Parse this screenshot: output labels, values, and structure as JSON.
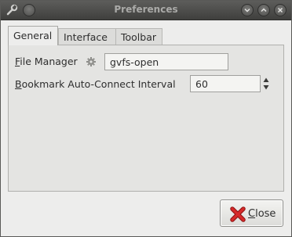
{
  "window": {
    "title": "Preferences",
    "tabs": [
      {
        "label": "General",
        "active": true
      },
      {
        "label": "Interface",
        "active": false
      },
      {
        "label": "Toolbar",
        "active": false
      }
    ]
  },
  "general": {
    "file_manager": {
      "mnemonic": "F",
      "label_rest": "ile Manager",
      "value": "gvfs-open",
      "icon": "gear-icon"
    },
    "bookmark_interval": {
      "mnemonic": "B",
      "label_rest": "ookmark Auto-Connect Interval",
      "value": "60"
    }
  },
  "footer": {
    "close_mnemonic": "C",
    "close_rest": "lose",
    "close_icon": "close-x-icon"
  },
  "colors": {
    "titlebar": "#4e4e4c",
    "window_bg": "#ededec",
    "close_x": "#cc1f1f"
  }
}
